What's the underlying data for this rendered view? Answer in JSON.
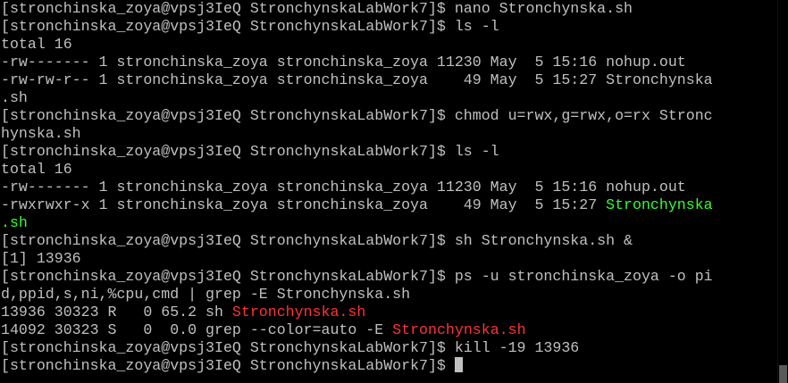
{
  "terminal": {
    "lines": [
      [
        {
          "text": "[stronchinska_zoya@vpsj3IeQ StronchynskaLabWork7]$ nano Stronchynska.sh"
        }
      ],
      [
        {
          "text": "[stronchinska_zoya@vpsj3IeQ StronchynskaLabWork7]$ ls -l"
        }
      ],
      [
        {
          "text": "total 16"
        }
      ],
      [
        {
          "text": "-rw------- 1 stronchinska_zoya stronchinska_zoya 11230 May  5 15:16 nohup.out"
        }
      ],
      [
        {
          "text": "-rw-rw-r-- 1 stronchinska_zoya stronchinska_zoya    49 May  5 15:27 Stronchynska"
        }
      ],
      [
        {
          "text": ".sh"
        }
      ],
      [
        {
          "text": "[stronchinska_zoya@vpsj3IeQ StronchynskaLabWork7]$ chmod u=rwx,g=rwx,o=rx Stronc"
        }
      ],
      [
        {
          "text": "hynska.sh"
        }
      ],
      [
        {
          "text": "[stronchinska_zoya@vpsj3IeQ StronchynskaLabWork7]$ ls -l"
        }
      ],
      [
        {
          "text": "total 16"
        }
      ],
      [
        {
          "text": "-rw------- 1 stronchinska_zoya stronchinska_zoya 11230 May  5 15:16 nohup.out"
        }
      ],
      [
        {
          "text": "-rwxrwxr-x 1 stronchinska_zoya stronchinska_zoya    49 May  5 15:27 "
        },
        {
          "text": "Stronchynska",
          "color": "green"
        }
      ],
      [
        {
          "text": ".sh",
          "color": "green"
        }
      ],
      [
        {
          "text": "[stronchinska_zoya@vpsj3IeQ StronchynskaLabWork7]$ sh Stronchynska.sh &"
        }
      ],
      [
        {
          "text": "[1] 13936"
        }
      ],
      [
        {
          "text": "[stronchinska_zoya@vpsj3IeQ StronchynskaLabWork7]$ ps -u stronchinska_zoya -o pi"
        }
      ],
      [
        {
          "text": "d,ppid,s,ni,%cpu,cmd | grep -E Stronchynska.sh"
        }
      ],
      [
        {
          "text": "13936 30323 R   0 65.2 sh "
        },
        {
          "text": "Stronchynska.sh",
          "color": "red"
        }
      ],
      [
        {
          "text": "14092 30323 S   0  0.0 grep --color=auto -E "
        },
        {
          "text": "Stronchynska.sh",
          "color": "red"
        }
      ],
      [
        {
          "text": "[stronchinska_zoya@vpsj3IeQ StronchynskaLabWork7]$ kill -19 13936"
        }
      ],
      [
        {
          "text": "[stronchinska_zoya@vpsj3IeQ StronchynskaLabWork7]$ "
        }
      ]
    ]
  },
  "colors": {
    "background": "#000000",
    "text": "#c0c0c0",
    "green": "#33ff33",
    "red": "#ff3333",
    "scroll_thumb": "#5a5a5a"
  },
  "icons": {
    "cursor": "block-cursor-icon"
  }
}
